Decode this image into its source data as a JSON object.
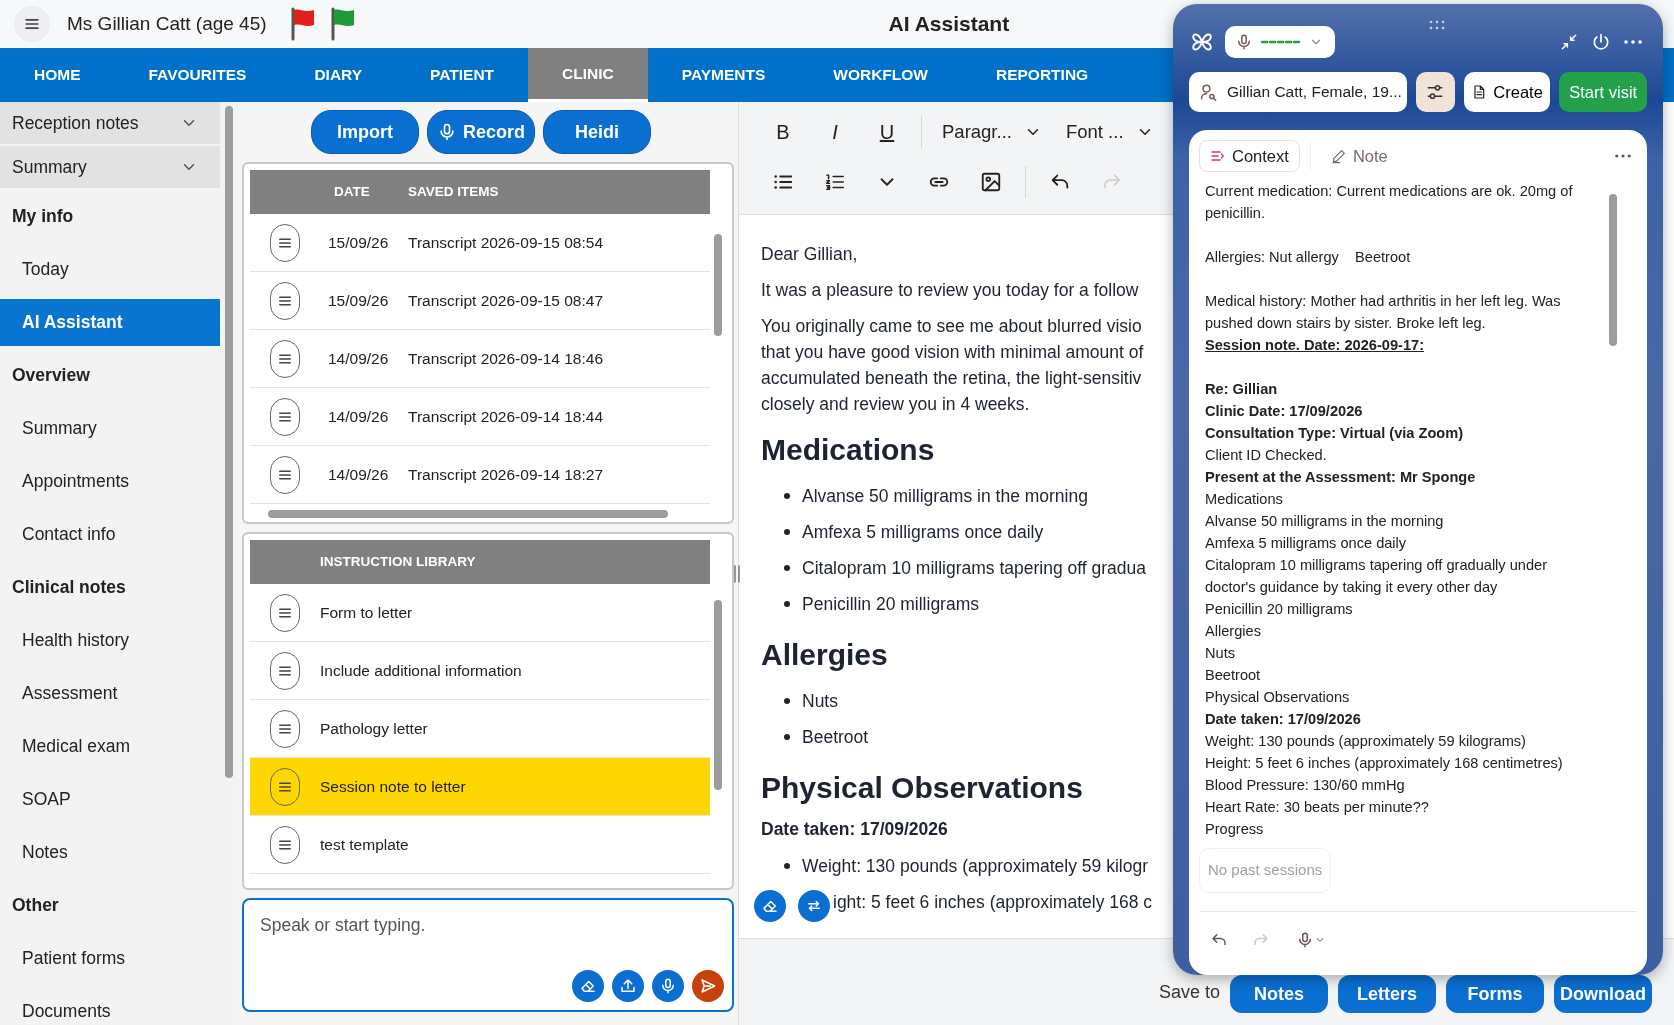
{
  "header": {
    "patient_name": "Ms Gillian Catt (age 45)",
    "title": "AI Assistant",
    "flags": [
      {
        "color": "#e0201c"
      },
      {
        "color": "#1f9a3a"
      }
    ]
  },
  "nav": [
    {
      "label": "HOME",
      "selected": false
    },
    {
      "label": "FAVOURITES",
      "selected": false
    },
    {
      "label": "DIARY",
      "selected": false
    },
    {
      "label": "PATIENT",
      "selected": false
    },
    {
      "label": "CLINIC",
      "selected": true
    },
    {
      "label": "PAYMENTS",
      "selected": false
    },
    {
      "label": "WORKFLOW",
      "selected": false
    },
    {
      "label": "REPORTING",
      "selected": false
    }
  ],
  "sidebar": {
    "items": [
      {
        "label": "Reception notes",
        "kind": "collapsible",
        "expanded": false,
        "selected": false
      },
      {
        "label": "Summary",
        "kind": "collapsible",
        "expanded": false,
        "selected": false
      },
      {
        "label": "My info",
        "kind": "section",
        "selected": false
      },
      {
        "label": "Today",
        "kind": "link",
        "selected": false
      },
      {
        "label": "AI Assistant",
        "kind": "link",
        "selected": true
      },
      {
        "label": "Overview",
        "kind": "section",
        "selected": false
      },
      {
        "label": "Summary",
        "kind": "link",
        "selected": false
      },
      {
        "label": "Appointments",
        "kind": "link",
        "selected": false
      },
      {
        "label": "Contact info",
        "kind": "link",
        "selected": false
      },
      {
        "label": "Clinical notes",
        "kind": "section",
        "selected": false
      },
      {
        "label": "Health history",
        "kind": "link",
        "selected": false
      },
      {
        "label": "Assessment",
        "kind": "link",
        "selected": false
      },
      {
        "label": "Medical exam",
        "kind": "link",
        "selected": false
      },
      {
        "label": "SOAP",
        "kind": "link",
        "selected": false
      },
      {
        "label": "Notes",
        "kind": "link",
        "selected": false
      },
      {
        "label": "Other",
        "kind": "section",
        "selected": false
      },
      {
        "label": "Patient forms",
        "kind": "link",
        "selected": false
      },
      {
        "label": "Documents",
        "kind": "link",
        "selected": false
      }
    ]
  },
  "actions": [
    {
      "label": "Import",
      "kind": "plain"
    },
    {
      "label": "Record",
      "kind": "voice"
    },
    {
      "label": "Heidi",
      "kind": "plain"
    }
  ],
  "saved_items": {
    "columns": [
      "DATE",
      "SAVED ITEMS"
    ],
    "rows": [
      {
        "date": "15/09/26",
        "name": "Transcript 2026-09-15 08:54"
      },
      {
        "date": "15/09/26",
        "name": "Transcript 2026-09-15 08:47"
      },
      {
        "date": "14/09/26",
        "name": "Transcript 2026-09-14 18:46"
      },
      {
        "date": "14/09/26",
        "name": "Transcript 2026-09-14 18:44"
      },
      {
        "date": "14/09/26",
        "name": "Transcript 2026-09-14 18:27"
      }
    ]
  },
  "instruction_library": {
    "columns": [
      "INSTRUCTION LIBRARY"
    ],
    "rows": [
      {
        "name": "Form to letter",
        "selected": false
      },
      {
        "name": "Include additional information",
        "selected": false
      },
      {
        "name": "Pathology letter",
        "selected": false
      },
      {
        "name": "Session note to letter",
        "selected": true
      },
      {
        "name": "test template",
        "selected": false
      }
    ]
  },
  "composer": {
    "placeholder": "Speak or start typing."
  },
  "editor": {
    "format_buttons": [
      {
        "label": "B",
        "kind": "bold"
      },
      {
        "label": "I",
        "kind": "italic"
      },
      {
        "label": "U",
        "kind": "underline"
      }
    ],
    "dropdowns": [
      "Paragr...",
      "Font ..."
    ],
    "history": [
      {
        "kind": "undo",
        "disabled": false
      },
      {
        "kind": "redo",
        "disabled": true
      }
    ],
    "blocks": [
      {
        "kind": "para",
        "lines": [
          "Dear Gillian,"
        ]
      },
      {
        "kind": "para",
        "lines": [
          "It was a pleasure to review you today for a follow"
        ]
      },
      {
        "kind": "para",
        "lines": [
          "You originally came to see me about blurred visio",
          "that you have good vision with minimal amount of",
          "accumulated beneath the retina, the light-sensitiv",
          "closely and review you in 4 weeks."
        ]
      },
      {
        "kind": "heading",
        "text": "Medications"
      },
      {
        "kind": "bullets",
        "items": [
          {
            "text": "Alvanse 50 milligrams in the morning",
            "bullet": true
          },
          {
            "text": "Amfexa 5 milligrams once daily",
            "bullet": true
          },
          {
            "text": "Citalopram 10 milligrams tapering off gradua",
            "bullet": true
          },
          {
            "text": "Penicillin 20 milligrams",
            "bullet": true
          }
        ]
      },
      {
        "kind": "heading",
        "text": "Allergies"
      },
      {
        "kind": "bullets",
        "items": [
          {
            "text": "Nuts",
            "bullet": true
          },
          {
            "text": "Beetroot",
            "bullet": true
          }
        ]
      },
      {
        "kind": "heading",
        "text": "Physical Observations"
      },
      {
        "kind": "bold",
        "text": "Date taken: 17/09/2026"
      },
      {
        "kind": "bullets",
        "items": [
          {
            "text": "Weight: 130 pounds (approximately 59 kilogr",
            "bullet": true
          },
          {
            "text": "ight: 5 feet 6 inches (approximately 168 c",
            "bullet": false
          }
        ]
      }
    ]
  },
  "save_bar": {
    "label": "Save to",
    "buttons": [
      "Notes",
      "Letters",
      "Forms",
      "Download"
    ]
  },
  "assistant": {
    "patient": "Gillian Catt, Female, 19...",
    "create": "Create",
    "start": "Start visit",
    "tabs": [
      {
        "label": "Context",
        "selected": true
      },
      {
        "label": "Note",
        "selected": false
      }
    ],
    "context_paragraphs": [
      [
        {
          "text": "Current medication: Current medications are ok. 20mg of penicillin.",
          "kind": "text"
        }
      ],
      [
        {
          "text": "Allergies: Nut allergy    Beetroot",
          "kind": "text"
        }
      ],
      [
        {
          "text": "Medical history: Mother had arthritis in her left leg. Was pushed down stairs by sister. Broke left leg.",
          "kind": "text"
        },
        {
          "text": "Session note. Date: 2026-09-17:",
          "kind": "heading"
        }
      ],
      [
        {
          "text": "Re: Gillian",
          "kind": "bold"
        },
        {
          "text": "Clinic Date: 17/09/2026",
          "kind": "bold"
        },
        {
          "text": "Consultation Type: Virtual (via Zoom)",
          "kind": "bold"
        },
        {
          "text": "Client ID Checked.",
          "kind": "text"
        },
        {
          "text": "Present at the Assessment: Mr Sponge",
          "kind": "bold"
        },
        {
          "text": "Medications",
          "kind": "text"
        },
        {
          "text": "Alvanse 50 milligrams in the morning",
          "kind": "text"
        },
        {
          "text": "Amfexa 5 milligrams once daily",
          "kind": "text"
        },
        {
          "text": "Citalopram 10 milligrams tapering off gradually under doctor's guidance by taking it every other day",
          "kind": "text"
        },
        {
          "text": "Penicillin 20 milligrams",
          "kind": "text"
        },
        {
          "text": "Allergies",
          "kind": "text"
        },
        {
          "text": "Nuts",
          "kind": "text"
        },
        {
          "text": "Beetroot",
          "kind": "text"
        },
        {
          "text": "Physical Observations",
          "kind": "text"
        },
        {
          "text": "Date taken: 17/09/2026",
          "kind": "bold"
        },
        {
          "text": "Weight: 130 pounds (approximately 59 kilograms)",
          "kind": "text"
        },
        {
          "text": "Height: 5 feet 6 inches (approximately 168 centimetres)",
          "kind": "text"
        },
        {
          "text": "Blood Pressure: 130/60 mmHg",
          "kind": "text"
        },
        {
          "text": "Heart Rate: 30 beats per minute??",
          "kind": "text"
        },
        {
          "text": "Progress",
          "kind": "text"
        }
      ]
    ],
    "past_sessions": "No past sessions",
    "history": [
      {
        "kind": "undo",
        "disabled": false
      },
      {
        "kind": "redo",
        "disabled": true
      }
    ]
  }
}
